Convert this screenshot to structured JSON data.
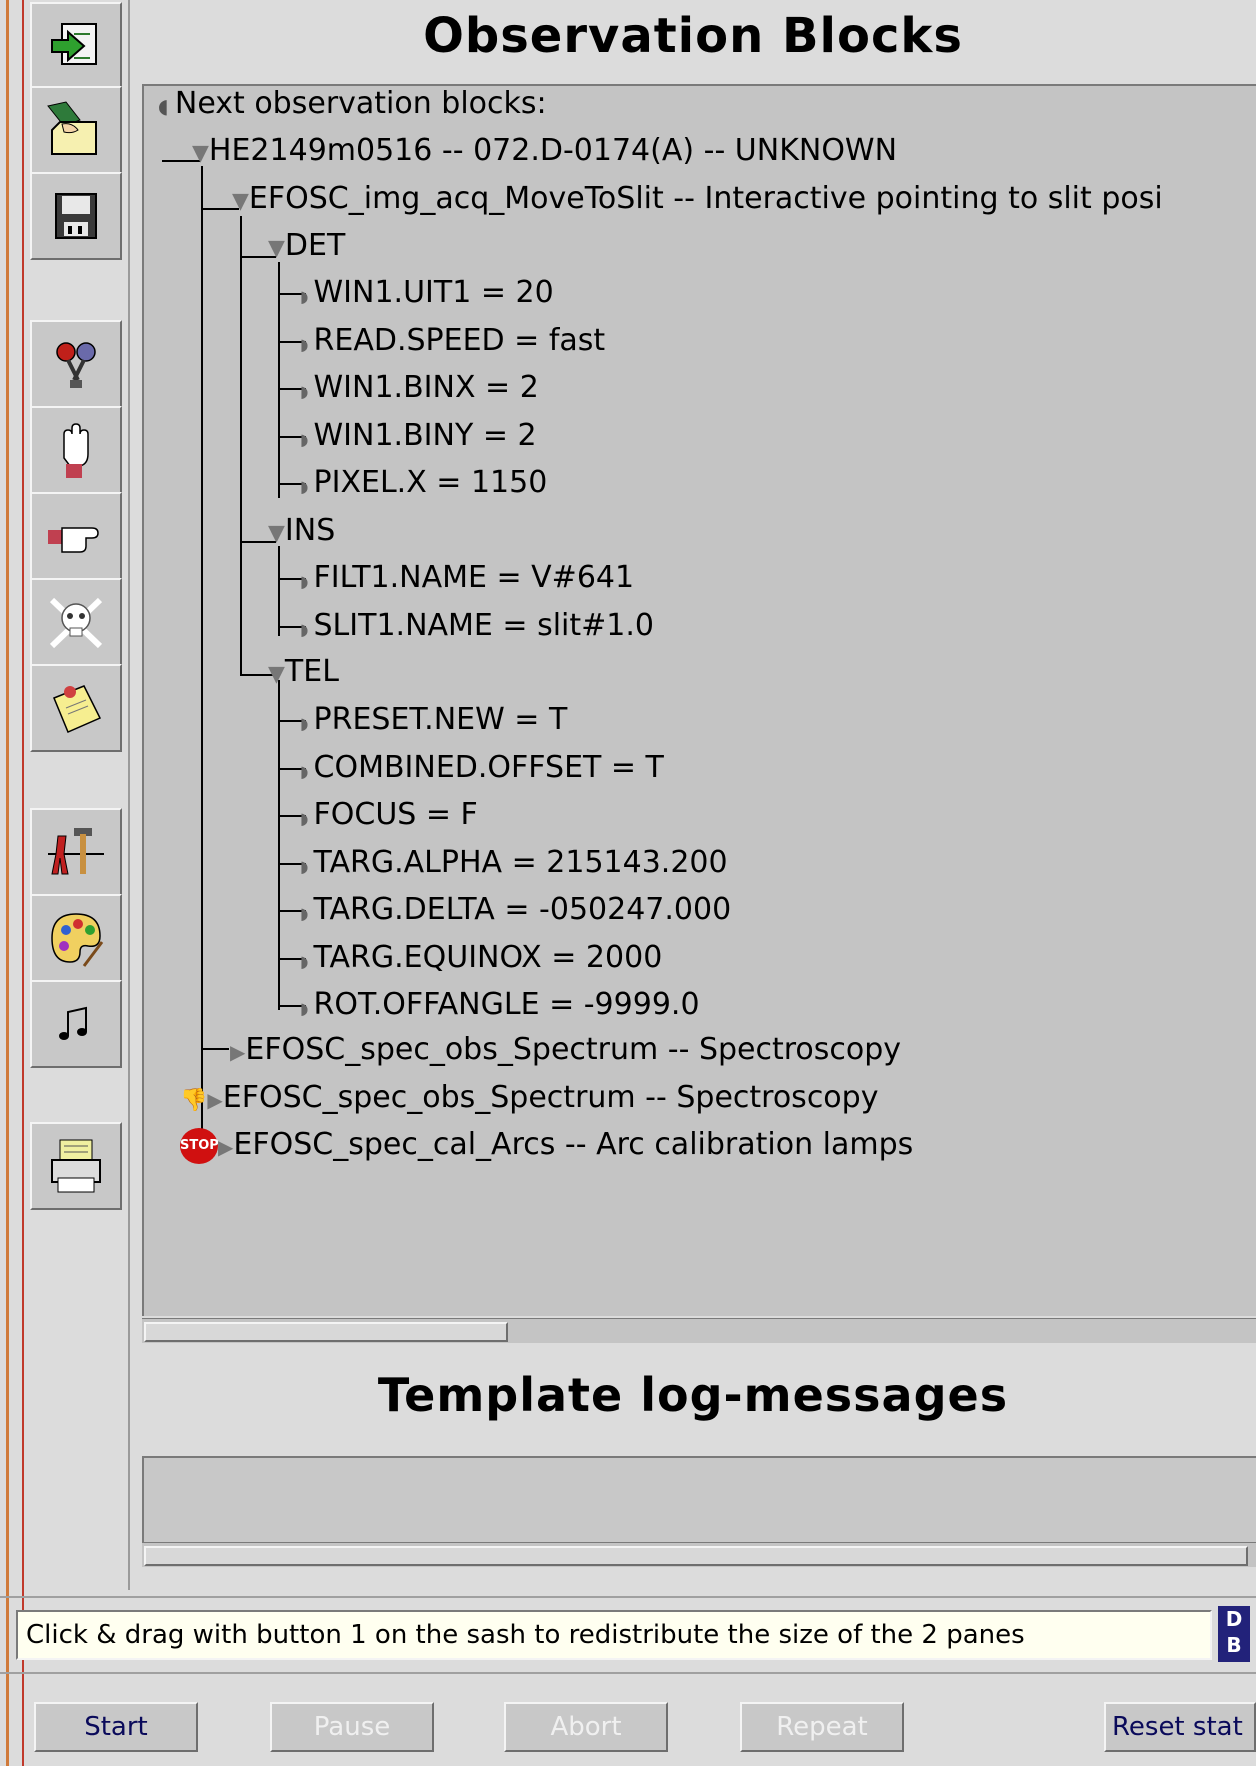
{
  "panels": {
    "observation_blocks_title": "Observation Blocks",
    "template_log_title": "Template log-messages"
  },
  "tree": {
    "root_label": "Next observation blocks:",
    "ob": "HE2149m0516 -- 072.D-0174(A) -- UNKNOWN",
    "template1": "EFOSC_img_acq_MoveToSlit -- Interactive pointing to slit posi",
    "det": {
      "label": "DET",
      "items": [
        "WIN1.UIT1 = 20",
        "READ.SPEED = fast",
        "WIN1.BINX = 2",
        "WIN1.BINY = 2",
        "PIXEL.X = 1150"
      ]
    },
    "ins": {
      "label": "INS",
      "items": [
        "FILT1.NAME = V#641",
        "SLIT1.NAME = slit#1.0"
      ]
    },
    "tel": {
      "label": "TEL",
      "items": [
        "PRESET.NEW = T",
        "COMBINED.OFFSET = T",
        "FOCUS = F",
        "TARG.ALPHA = 215143.200",
        "TARG.DELTA = -050247.000",
        "TARG.EQUINOX = 2000",
        "ROT.OFFANGLE = -9999.0"
      ]
    },
    "template2": "EFOSC_spec_obs_Spectrum -- Spectroscopy",
    "template3": "EFOSC_spec_obs_Spectrum -- Spectroscopy",
    "template4": "EFOSC_spec_cal_Arcs -- Arc calibration lamps",
    "stop_badge": "STOP"
  },
  "status": {
    "message": "Click & drag with button 1 on the sash to redistribute the size of the 2 panes",
    "db_icon": "D B"
  },
  "buttons": {
    "start": "Start",
    "pause": "Pause",
    "abort": "Abort",
    "repeat": "Repeat",
    "reset": "Reset stat"
  },
  "colors": {
    "panel_bg": "#c4c4c4",
    "window_bg": "#dcdcdc",
    "status_bg": "#fffff0",
    "button_text": "#0a0a5a",
    "disabled_text": "#f0f0f0"
  },
  "toolbar_icons": [
    "load-ob-icon",
    "hand-folder-icon",
    "save-disk-icon",
    "microphones-icon",
    "raised-hand-icon",
    "pointing-hand-icon",
    "skull-crossbones-icon",
    "sticky-note-icon",
    "tools-icon",
    "palette-icon",
    "music-note-icon",
    "printer-icon"
  ]
}
